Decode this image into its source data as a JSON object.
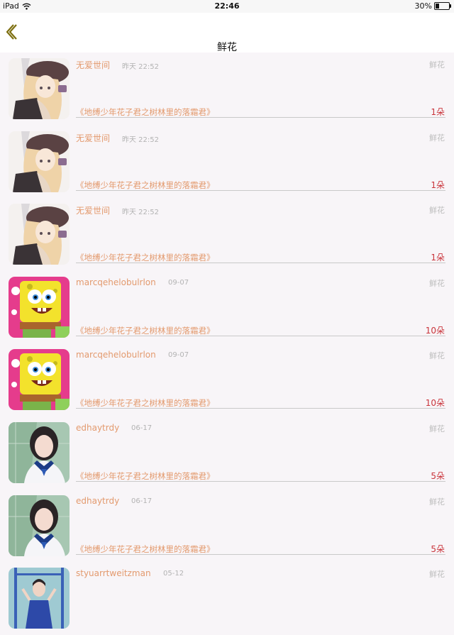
{
  "status": {
    "device": "iPad",
    "time": "22:46",
    "battery": "30%",
    "battery_level": 0.3
  },
  "nav": {
    "title": "鲜花",
    "back_icon": "chevron-left-icon",
    "accent_color": "#7d6f10"
  },
  "colors": {
    "username": "#e39a6e",
    "amount": "#c9343b",
    "muted": "#b3b3b3"
  },
  "list": [
    {
      "avatar": "anime-girl",
      "username": "无爱世间",
      "date": "昨天 22:52",
      "gift": "鲜花",
      "target": "《地缚少年花子君之树林里的落霜君》",
      "amount": "1朵"
    },
    {
      "avatar": "anime-girl",
      "username": "无爱世间",
      "date": "昨天 22:52",
      "gift": "鲜花",
      "target": "《地缚少年花子君之树林里的落霜君》",
      "amount": "1朵"
    },
    {
      "avatar": "anime-girl",
      "username": "无爱世间",
      "date": "昨天 22:52",
      "gift": "鲜花",
      "target": "《地缚少年花子君之树林里的落霜君》",
      "amount": "1朵"
    },
    {
      "avatar": "spongebob",
      "username": "marcqehelobulrlon",
      "date": "09-07",
      "gift": "鲜花",
      "target": "《地缚少年花子君之树林里的落霜君》",
      "amount": "10朵"
    },
    {
      "avatar": "spongebob",
      "username": "marcqehelobulrlon",
      "date": "09-07",
      "gift": "鲜花",
      "target": "《地缚少年花子君之树林里的落霜君》",
      "amount": "10朵"
    },
    {
      "avatar": "schoolgirl",
      "username": "edhaytrdy",
      "date": "06-17",
      "gift": "鲜花",
      "target": "《地缚少年花子君之树林里的落霜君》",
      "amount": "5朵"
    },
    {
      "avatar": "schoolgirl",
      "username": "edhaytrdy",
      "date": "06-17",
      "gift": "鲜花",
      "target": "《地缚少年花子君之树林里的落霜君》",
      "amount": "5朵"
    },
    {
      "avatar": "playground-girl",
      "username": "styuarrtweitzman",
      "date": "05-12",
      "gift": "鲜花",
      "target": "",
      "amount": ""
    }
  ]
}
